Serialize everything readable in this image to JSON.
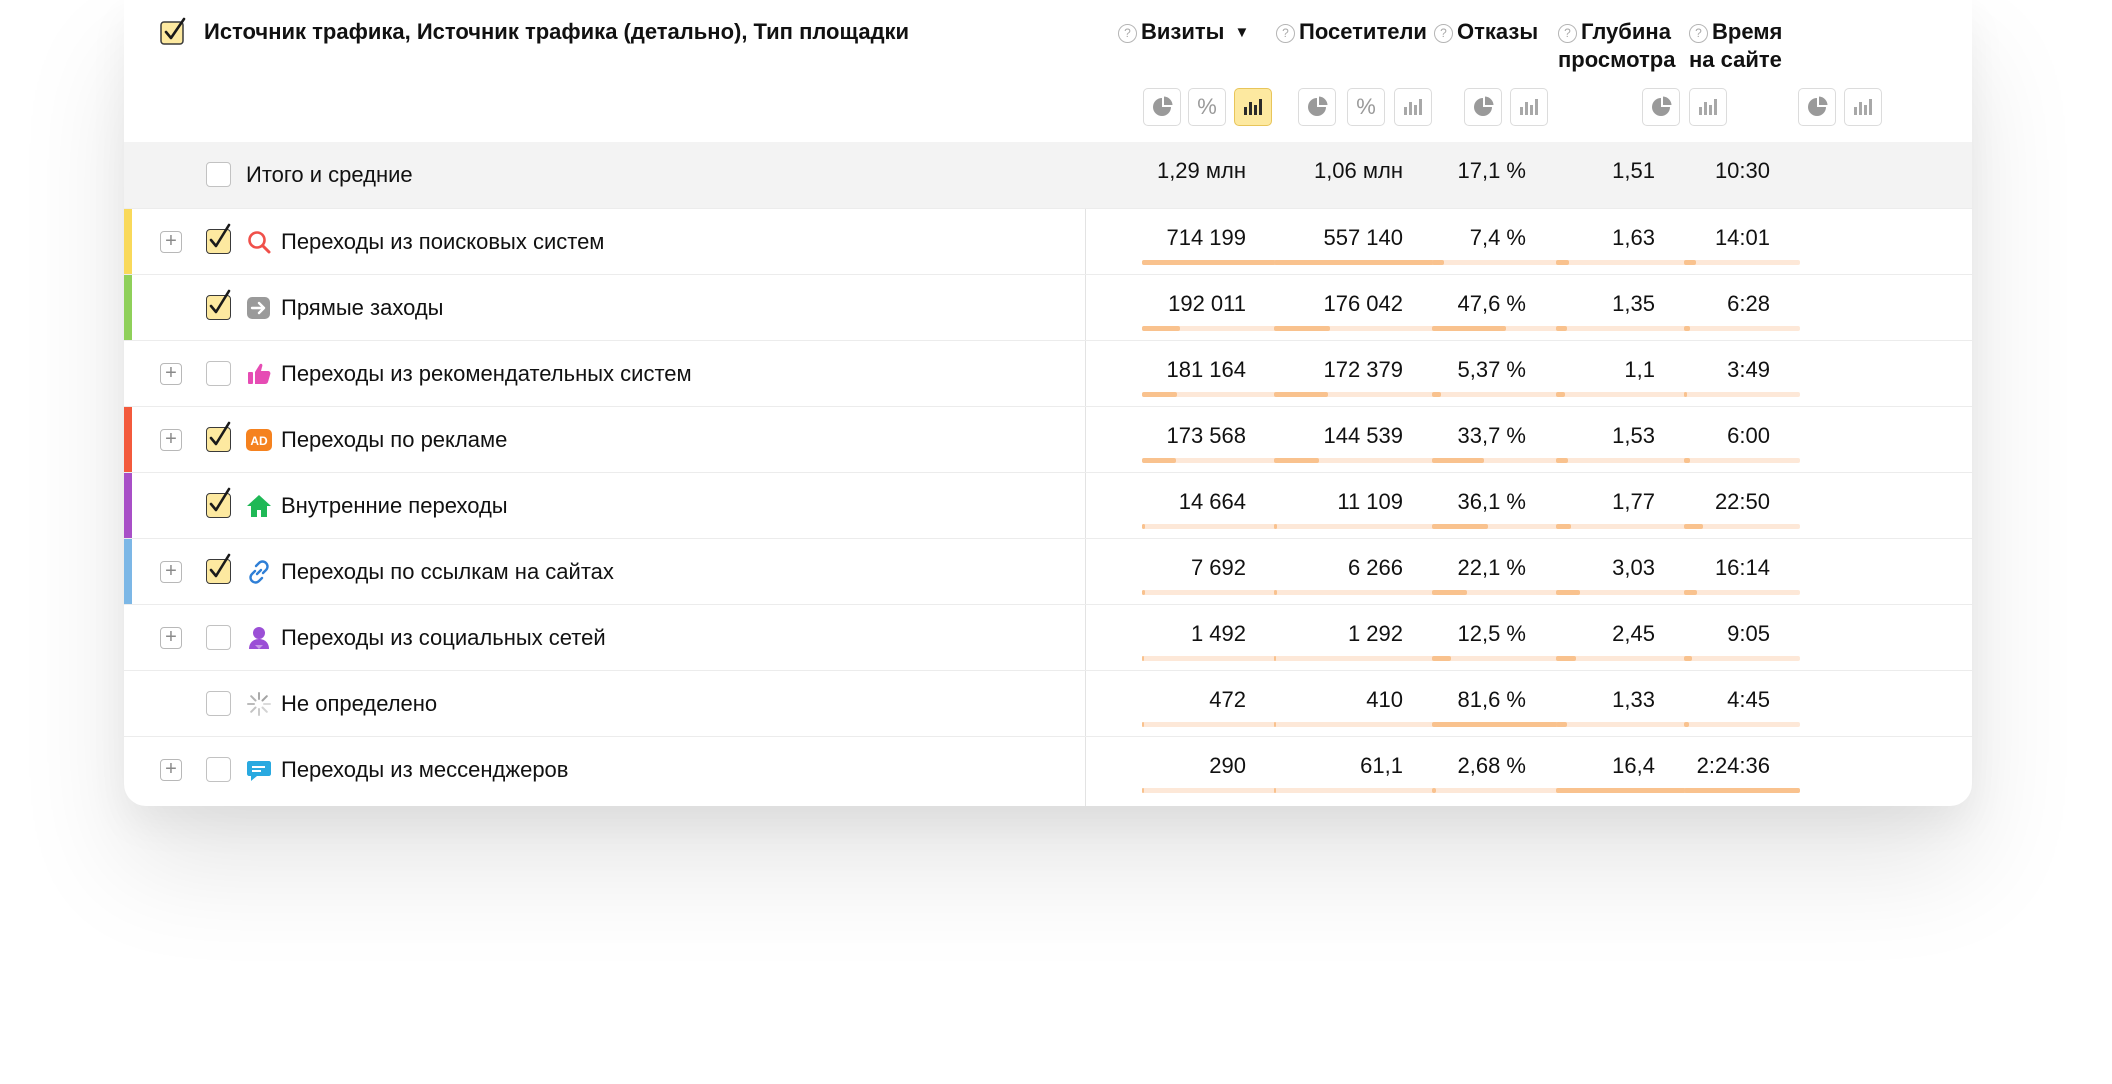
{
  "header": {
    "dimensions_title": "Источник трафика, Источник трафика (детально), Тип площадки",
    "columns": [
      {
        "key": "visits",
        "line1": "Визиты",
        "line2": "",
        "sorted": true
      },
      {
        "key": "visitors",
        "line1": "Посетители",
        "line2": ""
      },
      {
        "key": "bounces",
        "line1": "Отказы",
        "line2": ""
      },
      {
        "key": "depth",
        "line1": "Глубина",
        "line2": "просмотра"
      },
      {
        "key": "time",
        "line1": "Время",
        "line2": "на сайте"
      }
    ],
    "help_glyph": "?",
    "sort_glyph": "▼",
    "percent_glyph": "%",
    "icons": {
      "pie": "pie-chart-icon",
      "percent": "percent-icon",
      "bars": "bar-chart-icon"
    }
  },
  "totals": {
    "label": "Итого и средние",
    "visits": "1,29 млн",
    "visitors": "1,06 млн",
    "bounces": "17,1 %",
    "depth": "1,51",
    "time": "10:30"
  },
  "rows": [
    {
      "label": "Переходы из поисковых систем",
      "expandable": true,
      "checked": true,
      "color": "#f9d95a",
      "icon": "search-icon",
      "visits": "714 199",
      "visitors": "557 140",
      "bounces": "7,4 %",
      "depth": "1,63",
      "time": "14:01",
      "fill": {
        "visits": 1.0,
        "visitors": 1.0,
        "bounces": 0.09,
        "depth": 0.1,
        "time": 0.1
      }
    },
    {
      "label": "Прямые заходы",
      "expandable": false,
      "checked": true,
      "color": "#8fd05a",
      "icon": "direct-arrow-icon",
      "visits": "192 011",
      "visitors": "176 042",
      "bounces": "47,6 %",
      "depth": "1,35",
      "time": "6:28",
      "fill": {
        "visits": 0.27,
        "visitors": 0.32,
        "bounces": 0.58,
        "depth": 0.08,
        "time": 0.05
      }
    },
    {
      "label": "Переходы из рекомендательных систем",
      "expandable": true,
      "checked": false,
      "color": "",
      "icon": "thumbs-up-icon",
      "visits": "181 164",
      "visitors": "172 379",
      "bounces": "5,37 %",
      "depth": "1,1",
      "time": "3:49",
      "fill": {
        "visits": 0.25,
        "visitors": 0.31,
        "bounces": 0.07,
        "depth": 0.07,
        "time": 0.03
      }
    },
    {
      "label": "Переходы по рекламе",
      "expandable": true,
      "checked": true,
      "color": "#f35a3c",
      "icon": "ad-icon",
      "ad_text": "AD",
      "visits": "173 568",
      "visitors": "144 539",
      "bounces": "33,7 %",
      "depth": "1,53",
      "time": "6:00",
      "fill": {
        "visits": 0.24,
        "visitors": 0.26,
        "bounces": 0.41,
        "depth": 0.09,
        "time": 0.05
      }
    },
    {
      "label": "Внутренние переходы",
      "expandable": false,
      "checked": true,
      "color": "#a84fc7",
      "icon": "home-icon",
      "visits": "14 664",
      "visitors": "11 109",
      "bounces": "36,1 %",
      "depth": "1,77",
      "time": "22:50",
      "fill": {
        "visits": 0.02,
        "visitors": 0.02,
        "bounces": 0.44,
        "depth": 0.11,
        "time": 0.16
      }
    },
    {
      "label": "Переходы по ссылкам на сайтах",
      "expandable": true,
      "checked": true,
      "color": "#7cb7e6",
      "icon": "link-icon",
      "visits": "7 692",
      "visitors": "6 266",
      "bounces": "22,1 %",
      "depth": "3,03",
      "time": "16:14",
      "fill": {
        "visits": 0.01,
        "visitors": 0.01,
        "bounces": 0.27,
        "depth": 0.18,
        "time": 0.11
      }
    },
    {
      "label": "Переходы из социальных сетей",
      "expandable": true,
      "checked": false,
      "color": "",
      "icon": "social-user-icon",
      "visits": "1 492",
      "visitors": "1 292",
      "bounces": "12,5 %",
      "depth": "2,45",
      "time": "9:05",
      "fill": {
        "visits": 0.0,
        "visitors": 0.0,
        "bounces": 0.15,
        "depth": 0.15,
        "time": 0.07
      }
    },
    {
      "label": "Не определено",
      "expandable": false,
      "checked": false,
      "color": "",
      "icon": "loading-spinner-icon",
      "visits": "472",
      "visitors": "410",
      "bounces": "81,6 %",
      "depth": "1,33",
      "time": "4:45",
      "fill": {
        "visits": 0.0,
        "visitors": 0.0,
        "bounces": 1.0,
        "depth": 0.08,
        "time": 0.04
      }
    },
    {
      "label": "Переходы из мессенджеров",
      "expandable": true,
      "checked": false,
      "color": "",
      "icon": "messenger-bubble-icon",
      "visits": "290",
      "visitors": "61,1",
      "bounces": "2,68 %",
      "depth": "16,4",
      "time": "2:24:36",
      "fill": {
        "visits": 0.0,
        "visitors": 0.0,
        "bounces": 0.03,
        "depth": 1.0,
        "time": 1.0
      }
    }
  ]
}
